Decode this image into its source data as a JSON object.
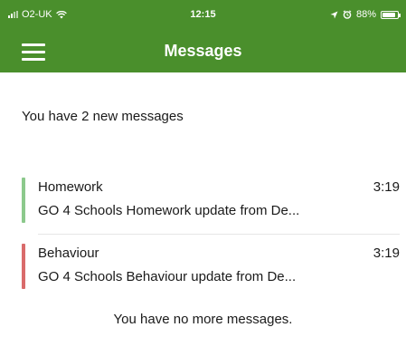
{
  "status_bar": {
    "carrier": "O2-UK",
    "time": "12:15",
    "battery": "88%",
    "battery_level": 0.88,
    "icons": [
      "signal-icon",
      "wifi-icon",
      "location-icon",
      "alarm-icon",
      "battery-icon"
    ]
  },
  "app_bar": {
    "title": "Messages",
    "menu_icon": "hamburger-menu-icon",
    "color": "#4a8f2c"
  },
  "summary": "You have 2 new messages",
  "messages": [
    {
      "title": "Homework",
      "time": "3:19",
      "preview": "GO 4 Schools Homework update from De...",
      "accent_color": "#8cc98c"
    },
    {
      "title": "Behaviour",
      "time": "3:19",
      "preview": "GO 4 Schools Behaviour update from De...",
      "accent_color": "#d96b6b"
    }
  ],
  "footer": "You have no more messages."
}
